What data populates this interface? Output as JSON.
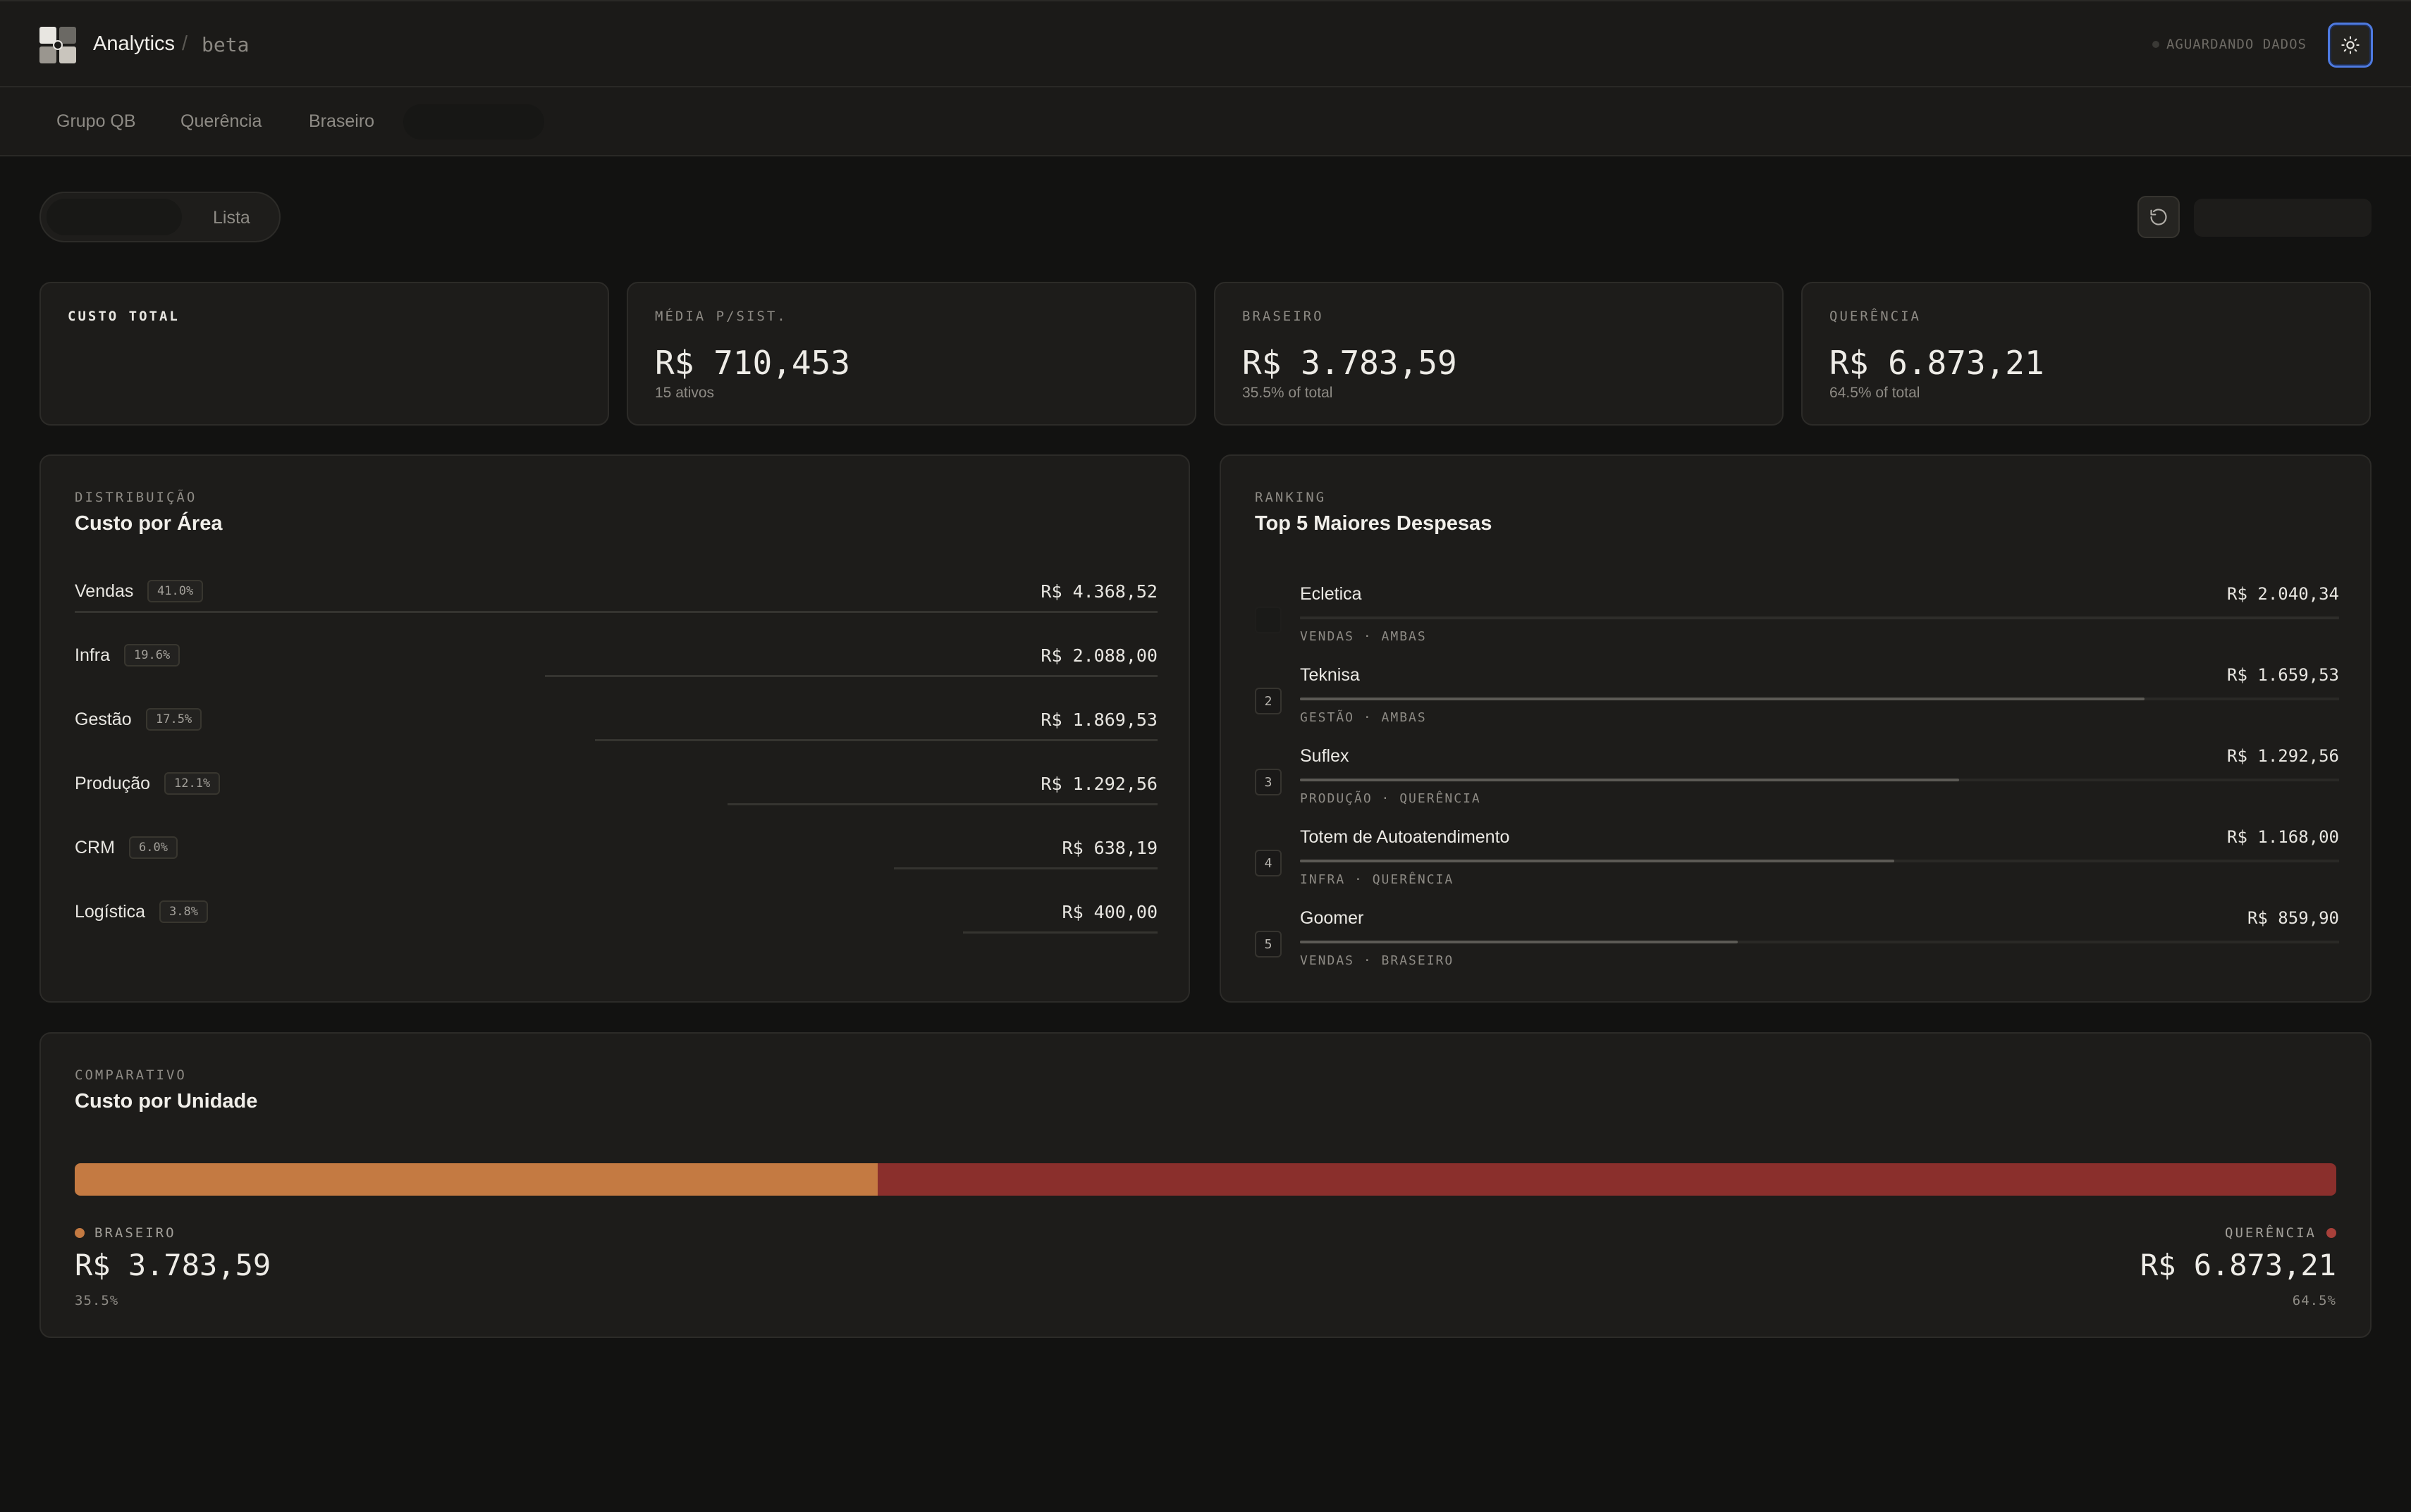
{
  "header": {
    "title": "Analytics",
    "separator": "/",
    "badge": "beta",
    "status": "AGUARDANDO DADOS",
    "theme_icon": "sun-icon"
  },
  "tabs": [
    {
      "label": "Grupo QB"
    },
    {
      "label": "Querência"
    },
    {
      "label": "Braseiro"
    }
  ],
  "toolbar": {
    "view_list_label": "Lista",
    "refresh_icon": "refresh-icon"
  },
  "kpis": [
    {
      "label": "CUSTO TOTAL",
      "value": "",
      "sub": ""
    },
    {
      "label": "MÉDIA P/SIST.",
      "value": "R$ 710,453",
      "sub": "15 ativos"
    },
    {
      "label": "BRASEIRO",
      "value": "R$ 3.783,59",
      "sub": "35.5% of total"
    },
    {
      "label": "QUERÊNCIA",
      "value": "R$ 6.873,21",
      "sub": "64.5% of total"
    }
  ],
  "distribution": {
    "eyebrow": "DISTRIBUIÇÃO",
    "title": "Custo por Área",
    "items": [
      {
        "name": "Vendas",
        "pct": "41.0%",
        "value": "R$ 4.368,52",
        "share": 0.41
      },
      {
        "name": "Infra",
        "pct": "19.6%",
        "value": "R$ 2.088,00",
        "share": 0.196
      },
      {
        "name": "Gestão",
        "pct": "17.5%",
        "value": "R$ 1.869,53",
        "share": 0.175
      },
      {
        "name": "Produção",
        "pct": "12.1%",
        "value": "R$ 1.292,56",
        "share": 0.121
      },
      {
        "name": "CRM",
        "pct": "6.0%",
        "value": "R$ 638,19",
        "share": 0.06
      },
      {
        "name": "Logística",
        "pct": "3.8%",
        "value": "R$ 400,00",
        "share": 0.038
      }
    ]
  },
  "ranking": {
    "eyebrow": "RANKING",
    "title": "Top 5 Maiores Despesas",
    "items": [
      {
        "rank": "",
        "name": "Ecletica",
        "value": "R$ 2.040,34",
        "meta": "VENDAS · AMBAS",
        "share": 1.0
      },
      {
        "rank": "2",
        "name": "Teknisa",
        "value": "R$ 1.659,53",
        "meta": "GESTÃO · AMBAS",
        "share": 0.813
      },
      {
        "rank": "3",
        "name": "Suflex",
        "value": "R$ 1.292,56",
        "meta": "PRODUÇÃO · QUERÊNCIA",
        "share": 0.634
      },
      {
        "rank": "4",
        "name": "Totem de Autoatendimento",
        "value": "R$ 1.168,00",
        "meta": "INFRA · QUERÊNCIA",
        "share": 0.572
      },
      {
        "rank": "5",
        "name": "Goomer",
        "value": "R$ 859,90",
        "meta": "VENDAS · BRASEIRO",
        "share": 0.421
      }
    ]
  },
  "comparative": {
    "eyebrow": "COMPARATIVO",
    "title": "Custo por Unidade",
    "left": {
      "label": "BRASEIRO",
      "value": "R$ 3.783,59",
      "pct": "35.5%",
      "share": 0.355,
      "color": "#c47a42"
    },
    "right": {
      "label": "QUERÊNCIA",
      "value": "R$ 6.873,21",
      "pct": "64.5%",
      "share": 0.645,
      "color": "#8a2f2c"
    }
  },
  "colors": {
    "accent_blue": "#4e7ae0",
    "braseiro": "#c47a42",
    "querencia": "#8a2f2c"
  }
}
